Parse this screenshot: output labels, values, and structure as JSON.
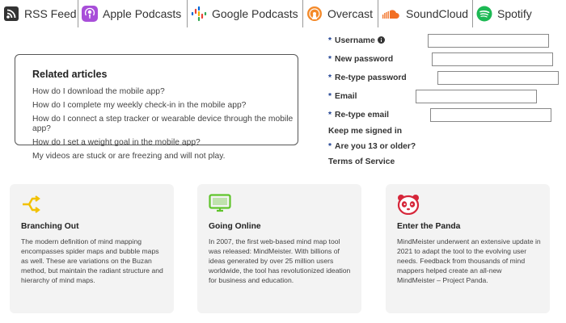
{
  "podcast_bar": [
    {
      "label": "RSS Feed",
      "icon": "rss-icon"
    },
    {
      "label": "Apple Podcasts",
      "icon": "apple-podcasts-icon"
    },
    {
      "label": "Google Podcasts",
      "icon": "google-podcasts-icon"
    },
    {
      "label": "Overcast",
      "icon": "overcast-icon"
    },
    {
      "label": "SoundCloud",
      "icon": "soundcloud-icon"
    },
    {
      "label": "Spotify",
      "icon": "spotify-icon"
    }
  ],
  "related": {
    "title": "Related articles",
    "items": [
      "How do I download the mobile app?",
      "How do I complete my weekly check-in in the mobile app?",
      "How do I connect a step tracker or wearable device through the mobile app?",
      "How do I set a weight goal in the mobile app?",
      "My videos are stuck or are freezing and will not play."
    ]
  },
  "signup": {
    "required_mark": "*",
    "username": "Username",
    "new_password": "New password",
    "retype_password": "Re-type password",
    "email": "Email",
    "retype_email": "Re-type email",
    "keep_signed_in": "Keep me signed in",
    "age_check": "Are you 13 or older?",
    "terms": "Terms of Service"
  },
  "cards": [
    {
      "icon": "branching-icon",
      "title": "Branching Out",
      "body": "The modern definition of mind mapping encompasses spider maps and bubble maps as well. These are variations on the Buzan method, but maintain the radiant structure and hierarchy of mind maps."
    },
    {
      "icon": "monitor-icon",
      "title": "Going Online",
      "body": "In 2007, the first web-based mind map tool was released: MindMeister. With billions of ideas generated by over 25 million users worldwide, the tool has revolutionized ideation for business and education."
    },
    {
      "icon": "panda-icon",
      "title": "Enter the Panda",
      "body": "MindMeister underwent an extensive update in 2021 to adapt the tool to the evolving user needs. Feedback from thousands of mind mappers helped create an all-new MindMeister – Project Panda."
    }
  ],
  "colors": {
    "apple_podcasts": "#a84ed9",
    "soundcloud": "#f26f23",
    "spotify": "#1db954",
    "overcast": "#f48a2a",
    "branching_accent": "#f2c100",
    "monitor_accent": "#5fc42b",
    "panda_accent": "#d6263a"
  }
}
